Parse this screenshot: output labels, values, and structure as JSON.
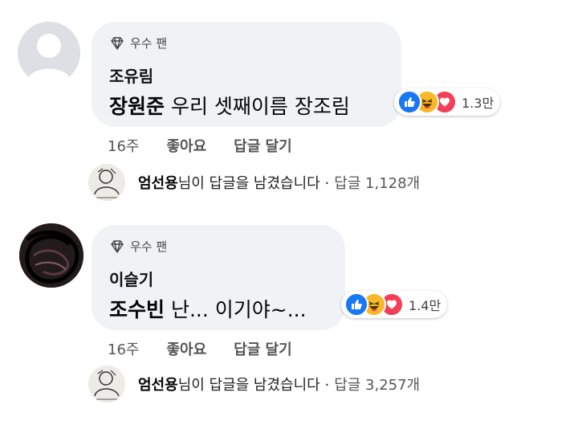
{
  "comments": [
    {
      "badge": "우수 팬",
      "author": "조유림",
      "tag": "장원준",
      "text": " 우리 셋째이름 장조림",
      "reaction_count": "1.3만",
      "time": "16주",
      "like_label": "좋아요",
      "reply_label": "답글 달기",
      "reply_author": "엄선용",
      "reply_text": "님이 답글을 남겼습니다 ·",
      "reply_count": "답글 1,128개"
    },
    {
      "badge": "우수 팬",
      "author": "이슬기",
      "tag": "조수빈",
      "text": " 난... 이기야~...",
      "reaction_count": "1.4만",
      "time": "16주",
      "like_label": "좋아요",
      "reply_label": "답글 달기",
      "reply_author": "엄선용",
      "reply_text": "님이 답글을 남겼습니다 ·",
      "reply_count": "답글 3,257개"
    }
  ],
  "colors": {
    "like": "#1877f2",
    "haha": "#f7b928",
    "love": "#f33e58",
    "bubble": "#f0f2f5"
  },
  "icons": [
    "diamond-icon",
    "like-reaction-icon",
    "haha-reaction-icon",
    "love-reaction-icon"
  ]
}
